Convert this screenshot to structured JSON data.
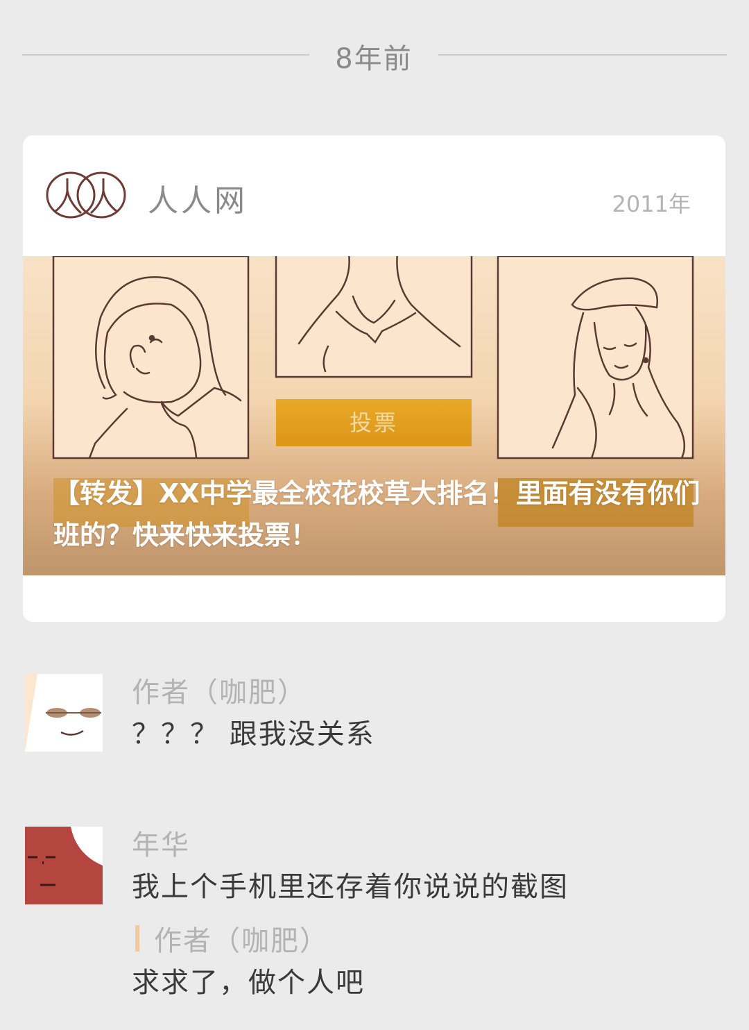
{
  "time_divider": "8年前",
  "card": {
    "logo_icon": "renren-logo-icon",
    "site_name": "人人网",
    "year": "2011年",
    "vote_button": "投票",
    "post_title": "【转发】XX中学最全校花校草大排名！里面有没有你们班的？快来快来投票！"
  },
  "comments": [
    {
      "author": "作者（咖肥）",
      "text": "？？？ 跟我没关系",
      "avatar_color": "#fbe6cf"
    },
    {
      "author": "年华",
      "text": "我上个手机里还存着你说说的截图",
      "avatar_color": "#b5463f",
      "reply": {
        "author": "作者（咖肥）",
        "text": "求求了，做个人吧"
      }
    }
  ],
  "colors": {
    "background": "#ebebeb",
    "card": "#ffffff",
    "accent": "#e2a024",
    "reply_bar": "#f3c9a0"
  }
}
